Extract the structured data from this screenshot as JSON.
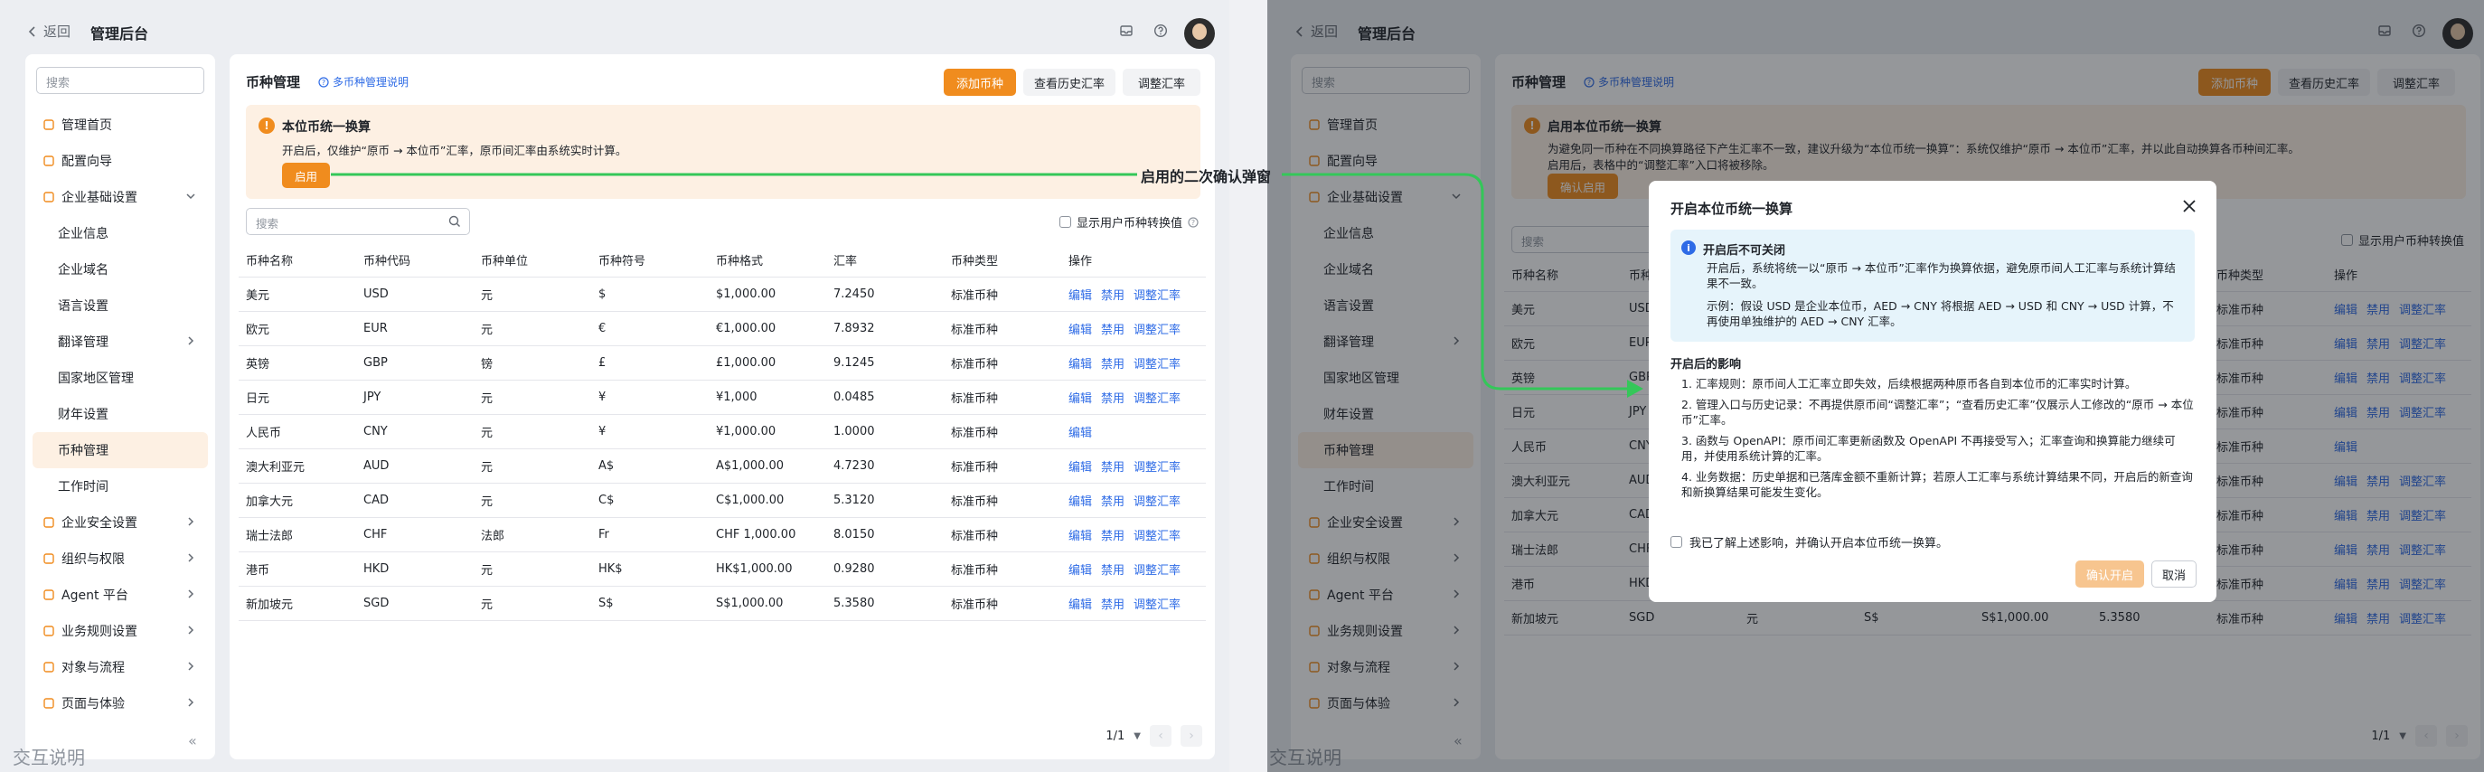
{
  "colors": {
    "accent": "#f08c1e",
    "link": "#2e6be6",
    "connector": "#34c759"
  },
  "topbar": {
    "back_label": "返回",
    "title": "管理后台",
    "icons": [
      "inbox-icon",
      "help-icon"
    ]
  },
  "sidebar": {
    "search_placeholder": "搜索",
    "items": [
      {
        "label": "管理首页",
        "icon": "home-icon",
        "level": 0
      },
      {
        "label": "配置向导",
        "icon": "guide-icon",
        "level": 0
      },
      {
        "label": "企业基础设置",
        "icon": "building-icon",
        "level": 0,
        "expanded": true
      },
      {
        "label": "企业信息",
        "level": 1
      },
      {
        "label": "企业域名",
        "level": 1
      },
      {
        "label": "语言设置",
        "level": 1
      },
      {
        "label": "翻译管理",
        "level": 1,
        "has_children": true
      },
      {
        "label": "国家地区管理",
        "level": 1
      },
      {
        "label": "财年设置",
        "level": 1
      },
      {
        "label": "币种管理",
        "level": 1,
        "active": true
      },
      {
        "label": "工作时间",
        "level": 1
      },
      {
        "label": "企业安全设置",
        "icon": "shield-icon",
        "level": 0,
        "has_children": true
      },
      {
        "label": "组织与权限",
        "icon": "user-icon",
        "level": 0,
        "has_children": true
      },
      {
        "label": "Agent 平台",
        "icon": "robot-icon",
        "level": 0,
        "has_children": true
      },
      {
        "label": "业务规则设置",
        "icon": "rules-icon",
        "level": 0,
        "has_children": true
      },
      {
        "label": "对象与流程",
        "icon": "flow-icon",
        "level": 0,
        "has_children": true
      },
      {
        "label": "页面与体验",
        "icon": "layout-icon",
        "level": 0,
        "has_children": true
      }
    ]
  },
  "main": {
    "title": "币种管理",
    "help_link": "多币种管理说明",
    "buttons": {
      "add": "添加币种",
      "history": "查看历史汇率",
      "adjust": "调整汇率"
    },
    "alert_left": {
      "title": "本位币统一换算",
      "desc": "开启后，仅维护“原币 → 本位币”汇率，原币间汇率由系统实时计算。",
      "button": "启用"
    },
    "alert_right": {
      "title": "启用本位币统一换算",
      "desc1": "为避免同一币种在不同换算路径下产生汇率不一致，建议升级为“本位币统一换算”：系统仅维护“原币 → 本位币”汇率，并以此自动换算各币种间汇率。",
      "desc2": "启用后，表格中的“调整汇率”入口将被移除。",
      "button": "确认启用"
    },
    "filter_placeholder": "搜索",
    "toggle_label": "显示用户币种转换值",
    "columns": [
      "币种名称",
      "币种代码",
      "币种单位",
      "币种符号",
      "币种格式",
      "汇率",
      "币种类型",
      "操作"
    ],
    "rows": [
      [
        "美元",
        "USD",
        "元",
        "$",
        "$1,000.00",
        "7.2450",
        "标准币种"
      ],
      [
        "欧元",
        "EUR",
        "元",
        "€",
        "€1,000.00",
        "7.8932",
        "标准币种"
      ],
      [
        "英镑",
        "GBP",
        "镑",
        "£",
        "£1,000.00",
        "9.1245",
        "标准币种"
      ],
      [
        "日元",
        "JPY",
        "元",
        "¥",
        "¥1,000",
        "0.0485",
        "标准币种"
      ],
      [
        "人民币",
        "CNY",
        "元",
        "¥",
        "¥1,000.00",
        "1.0000",
        "标准币种"
      ],
      [
        "澳大利亚元",
        "AUD",
        "元",
        "A$",
        "A$1,000.00",
        "4.7230",
        "标准币种"
      ],
      [
        "加拿大元",
        "CAD",
        "元",
        "C$",
        "C$1,000.00",
        "5.3120",
        "标准币种"
      ],
      [
        "瑞士法郎",
        "CHF",
        "法郎",
        "Fr",
        "CHF 1,000.00",
        "8.0150",
        "标准币种"
      ],
      [
        "港币",
        "HKD",
        "元",
        "HK$",
        "HK$1,000.00",
        "0.9280",
        "标准币种"
      ],
      [
        "新加坡元",
        "SGD",
        "元",
        "S$",
        "S$1,000.00",
        "5.3580",
        "标准币种"
      ]
    ],
    "ops": {
      "edit": "编辑",
      "disable": "禁用",
      "adjust": "调整汇率"
    },
    "pager": "1/1"
  },
  "watermark": "交互说明",
  "callout": "启用的二次确认弹窗",
  "modal": {
    "title": "开启本位币统一换算",
    "info_title": "开启后不可关闭",
    "info_p1": "开启后，系统将统一以“原币 → 本位币”汇率作为换算依据，避免原币间人工汇率与系统计算结果不一致。",
    "info_p2": "示例：假设 USD 是企业本位币，AED → CNY 将根据 AED → USD 和 CNY → USD 计算，不再使用单独维护的 AED → CNY 汇率。",
    "section_title": "开启后的影响",
    "impacts": [
      "1. 汇率规则：原币间人工汇率立即失效，后续根据两种原币各自到本位币的汇率实时计算。",
      "2. 管理入口与历史记录：不再提供原币间“调整汇率”；“查看历史汇率”仅展示人工修改的“原币 → 本位币”汇率。",
      "3. 函数与 OpenAPI：原币间汇率更新函数及 OpenAPI 不再接受写入；汇率查询和换算能力继续可用，并使用系统计算的汇率。",
      "4. 业务数据：历史单据和已落库金额不重新计算；若原人工汇率与系统计算结果不同，开启后的新查询和新换算结果可能发生变化。"
    ],
    "confirm_label": "我已了解上述影响，并确认开启本位币统一换算。",
    "ok": "确认开启",
    "cancel": "取消"
  }
}
